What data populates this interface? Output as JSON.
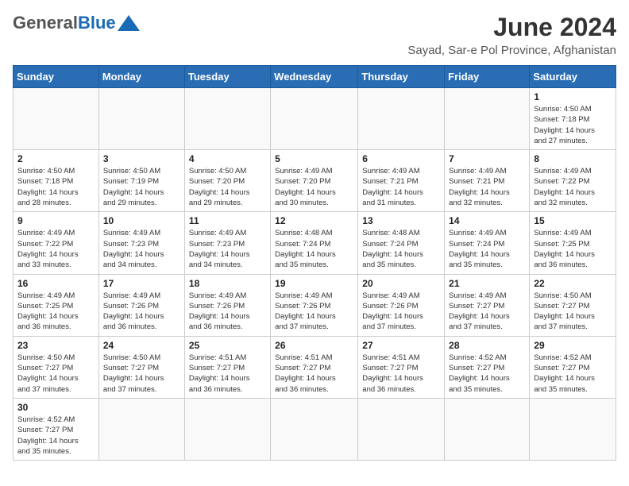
{
  "header": {
    "logo_general": "General",
    "logo_blue": "Blue",
    "month_title": "June 2024",
    "location": "Sayad, Sar-e Pol Province, Afghanistan"
  },
  "weekdays": [
    "Sunday",
    "Monday",
    "Tuesday",
    "Wednesday",
    "Thursday",
    "Friday",
    "Saturday"
  ],
  "weeks": [
    [
      {
        "day": "",
        "info": ""
      },
      {
        "day": "",
        "info": ""
      },
      {
        "day": "",
        "info": ""
      },
      {
        "day": "",
        "info": ""
      },
      {
        "day": "",
        "info": ""
      },
      {
        "day": "",
        "info": ""
      },
      {
        "day": "1",
        "info": "Sunrise: 4:50 AM\nSunset: 7:18 PM\nDaylight: 14 hours\nand 27 minutes."
      }
    ],
    [
      {
        "day": "2",
        "info": "Sunrise: 4:50 AM\nSunset: 7:18 PM\nDaylight: 14 hours\nand 28 minutes."
      },
      {
        "day": "3",
        "info": "Sunrise: 4:50 AM\nSunset: 7:19 PM\nDaylight: 14 hours\nand 29 minutes."
      },
      {
        "day": "4",
        "info": "Sunrise: 4:50 AM\nSunset: 7:20 PM\nDaylight: 14 hours\nand 29 minutes."
      },
      {
        "day": "5",
        "info": "Sunrise: 4:49 AM\nSunset: 7:20 PM\nDaylight: 14 hours\nand 30 minutes."
      },
      {
        "day": "6",
        "info": "Sunrise: 4:49 AM\nSunset: 7:21 PM\nDaylight: 14 hours\nand 31 minutes."
      },
      {
        "day": "7",
        "info": "Sunrise: 4:49 AM\nSunset: 7:21 PM\nDaylight: 14 hours\nand 32 minutes."
      },
      {
        "day": "8",
        "info": "Sunrise: 4:49 AM\nSunset: 7:22 PM\nDaylight: 14 hours\nand 32 minutes."
      }
    ],
    [
      {
        "day": "9",
        "info": "Sunrise: 4:49 AM\nSunset: 7:22 PM\nDaylight: 14 hours\nand 33 minutes."
      },
      {
        "day": "10",
        "info": "Sunrise: 4:49 AM\nSunset: 7:23 PM\nDaylight: 14 hours\nand 34 minutes."
      },
      {
        "day": "11",
        "info": "Sunrise: 4:49 AM\nSunset: 7:23 PM\nDaylight: 14 hours\nand 34 minutes."
      },
      {
        "day": "12",
        "info": "Sunrise: 4:48 AM\nSunset: 7:24 PM\nDaylight: 14 hours\nand 35 minutes."
      },
      {
        "day": "13",
        "info": "Sunrise: 4:48 AM\nSunset: 7:24 PM\nDaylight: 14 hours\nand 35 minutes."
      },
      {
        "day": "14",
        "info": "Sunrise: 4:49 AM\nSunset: 7:24 PM\nDaylight: 14 hours\nand 35 minutes."
      },
      {
        "day": "15",
        "info": "Sunrise: 4:49 AM\nSunset: 7:25 PM\nDaylight: 14 hours\nand 36 minutes."
      }
    ],
    [
      {
        "day": "16",
        "info": "Sunrise: 4:49 AM\nSunset: 7:25 PM\nDaylight: 14 hours\nand 36 minutes."
      },
      {
        "day": "17",
        "info": "Sunrise: 4:49 AM\nSunset: 7:26 PM\nDaylight: 14 hours\nand 36 minutes."
      },
      {
        "day": "18",
        "info": "Sunrise: 4:49 AM\nSunset: 7:26 PM\nDaylight: 14 hours\nand 36 minutes."
      },
      {
        "day": "19",
        "info": "Sunrise: 4:49 AM\nSunset: 7:26 PM\nDaylight: 14 hours\nand 37 minutes."
      },
      {
        "day": "20",
        "info": "Sunrise: 4:49 AM\nSunset: 7:26 PM\nDaylight: 14 hours\nand 37 minutes."
      },
      {
        "day": "21",
        "info": "Sunrise: 4:49 AM\nSunset: 7:27 PM\nDaylight: 14 hours\nand 37 minutes."
      },
      {
        "day": "22",
        "info": "Sunrise: 4:50 AM\nSunset: 7:27 PM\nDaylight: 14 hours\nand 37 minutes."
      }
    ],
    [
      {
        "day": "23",
        "info": "Sunrise: 4:50 AM\nSunset: 7:27 PM\nDaylight: 14 hours\nand 37 minutes."
      },
      {
        "day": "24",
        "info": "Sunrise: 4:50 AM\nSunset: 7:27 PM\nDaylight: 14 hours\nand 37 minutes."
      },
      {
        "day": "25",
        "info": "Sunrise: 4:51 AM\nSunset: 7:27 PM\nDaylight: 14 hours\nand 36 minutes."
      },
      {
        "day": "26",
        "info": "Sunrise: 4:51 AM\nSunset: 7:27 PM\nDaylight: 14 hours\nand 36 minutes."
      },
      {
        "day": "27",
        "info": "Sunrise: 4:51 AM\nSunset: 7:27 PM\nDaylight: 14 hours\nand 36 minutes."
      },
      {
        "day": "28",
        "info": "Sunrise: 4:52 AM\nSunset: 7:27 PM\nDaylight: 14 hours\nand 35 minutes."
      },
      {
        "day": "29",
        "info": "Sunrise: 4:52 AM\nSunset: 7:27 PM\nDaylight: 14 hours\nand 35 minutes."
      }
    ],
    [
      {
        "day": "30",
        "info": "Sunrise: 4:52 AM\nSunset: 7:27 PM\nDaylight: 14 hours\nand 35 minutes."
      },
      {
        "day": "",
        "info": ""
      },
      {
        "day": "",
        "info": ""
      },
      {
        "day": "",
        "info": ""
      },
      {
        "day": "",
        "info": ""
      },
      {
        "day": "",
        "info": ""
      },
      {
        "day": "",
        "info": ""
      }
    ]
  ]
}
